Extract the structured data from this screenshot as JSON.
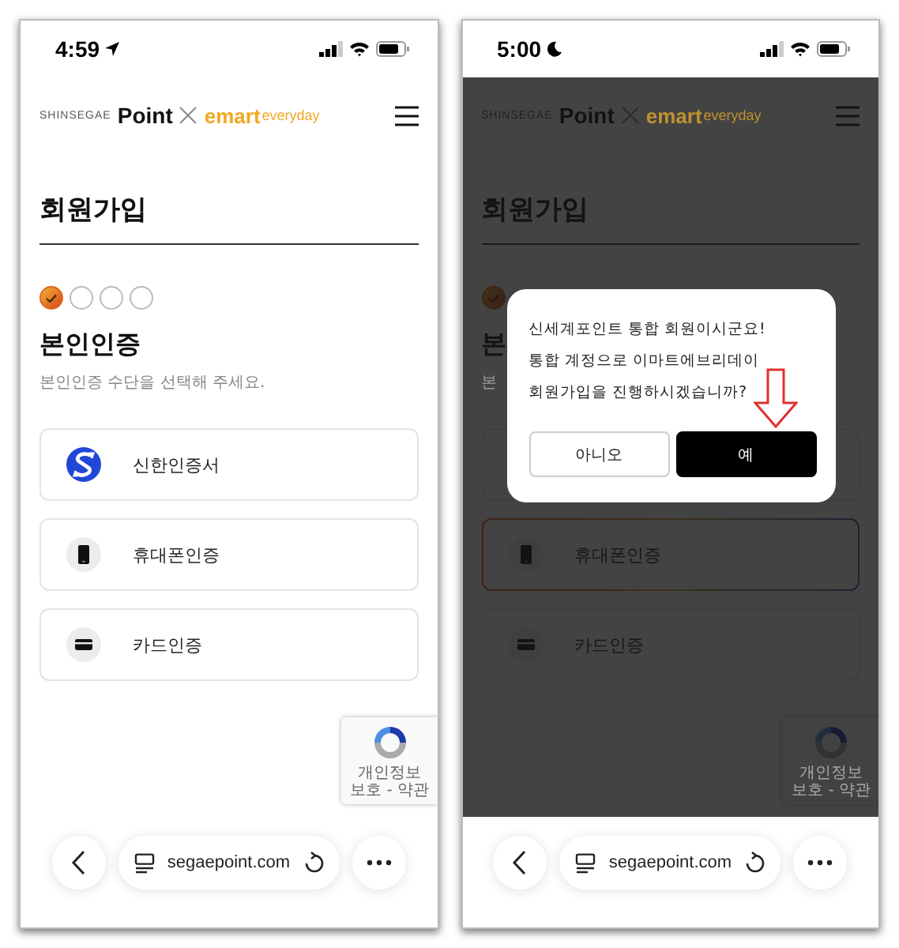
{
  "screens": [
    {
      "status_bar": {
        "time": "4:59",
        "indicator": {
          "kind": "location"
        }
      },
      "logo": {
        "brand": "SHINSEGAE",
        "point": "Point",
        "emart": "emart",
        "everyday": "everyday"
      },
      "title": "회원가입",
      "steps": [
        {
          "checked": true
        },
        {
          "checked": false
        },
        {
          "checked": false
        },
        {
          "checked": false
        }
      ],
      "section_title": "본인인증",
      "subtitle": "본인인증 수단을 선택해 주세요.",
      "methods": [
        {
          "kind": "shinhan",
          "label": "신한인증서",
          "selected": false
        },
        {
          "kind": "phone",
          "label": "휴대폰인증",
          "selected": false
        },
        {
          "kind": "card",
          "label": "카드인증",
          "selected": false
        }
      ],
      "recaptcha": {
        "text": "개인정보 보호 - 약관"
      },
      "address_bar": {
        "url": "segaepoint.com"
      }
    },
    {
      "status_bar": {
        "time": "5:00",
        "indicator": {
          "kind": "moon"
        }
      },
      "logo": {
        "brand": "SHINSEGAE",
        "point": "Point",
        "emart": "emart",
        "everyday": "everyday"
      },
      "title": "회원가입",
      "steps": [
        {
          "checked": true
        }
      ],
      "section_title": "본",
      "subtitle": "본",
      "methods": [
        {
          "kind": "empty",
          "selected": false
        },
        {
          "kind": "phone",
          "label": "휴대폰인증",
          "selected": true
        },
        {
          "kind": "card",
          "label": "카드인증",
          "selected": false
        }
      ],
      "recaptcha": {
        "text": "개인정보 보호 - 약관"
      },
      "address_bar": {
        "url": "segaepoint.com"
      },
      "dialog": {
        "lines": [
          "신세계포인트 통합 회원이시군요!",
          "통합 계정으로 이마트에브리데이",
          "회원가입을 진행하시겠습니까?"
        ],
        "buttons": [
          {
            "label": "아니오",
            "kind": "secondary"
          },
          {
            "label": "예",
            "kind": "primary"
          }
        ]
      }
    }
  ]
}
